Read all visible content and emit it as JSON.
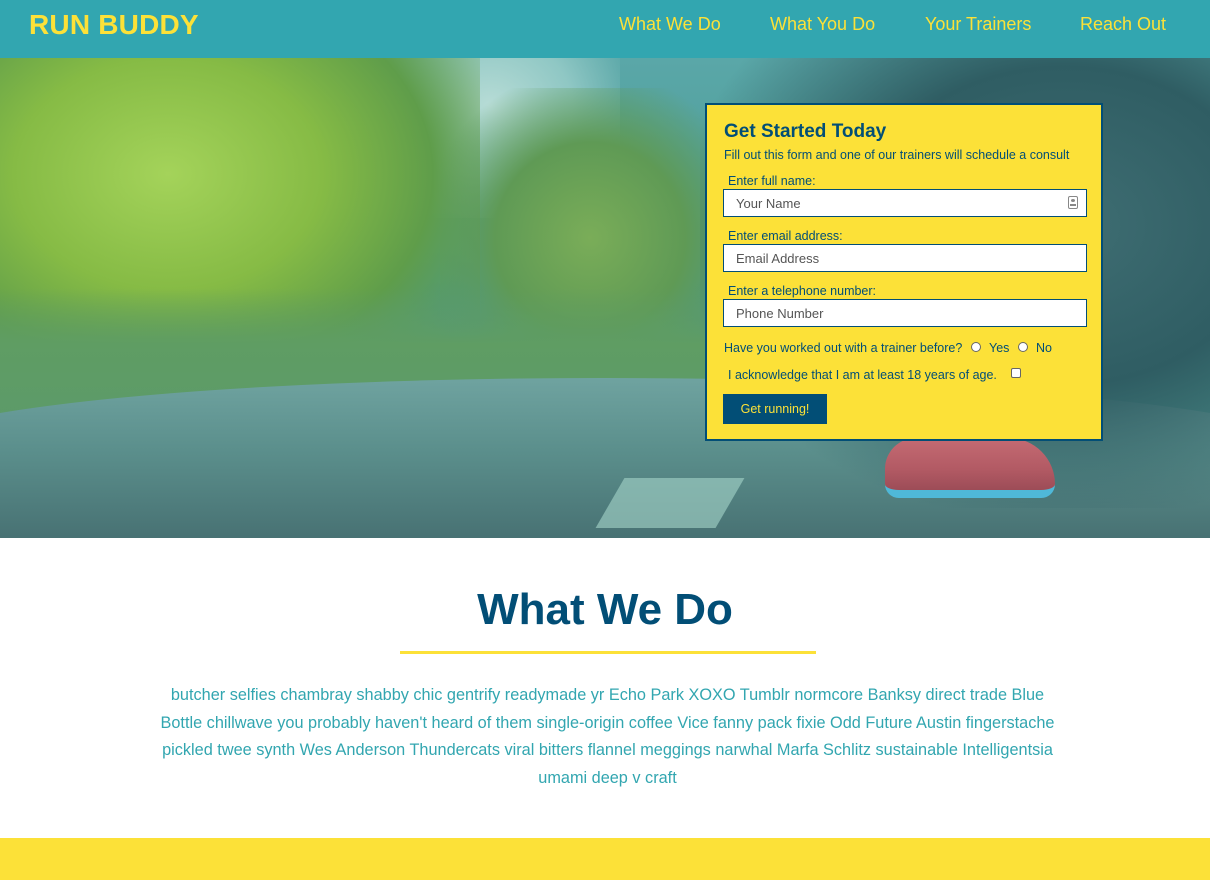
{
  "header": {
    "brand": "RUN BUDDY",
    "nav": [
      {
        "label": "What We Do"
      },
      {
        "label": "What You Do"
      },
      {
        "label": "Your Trainers"
      },
      {
        "label": "Reach Out"
      }
    ]
  },
  "form": {
    "title": "Get Started Today",
    "subtitle": "Fill out this form and one of our trainers will schedule a consult",
    "name_label": "Enter full name:",
    "name_placeholder": "Your Name",
    "email_label": "Enter email address:",
    "email_placeholder": "Email Address",
    "phone_label": "Enter a telephone number:",
    "phone_placeholder": "Phone Number",
    "trainer_question": "Have you worked out with a trainer before?",
    "yes_label": "Yes",
    "no_label": "No",
    "age_ack": "I acknowledge that I am at least 18 years of age.",
    "submit_label": "Get running!"
  },
  "what_we_do": {
    "title": "What We Do",
    "body": "butcher selfies chambray shabby chic gentrify readymade yr Echo Park XOXO Tumblr normcore Banksy direct trade Blue Bottle chillwave you probably haven't heard of them single-origin coffee Vice fanny pack fixie Odd Future Austin fingerstache pickled twee synth Wes Anderson Thundercats viral bitters flannel meggings narwhal Marfa Schlitz sustainable Intelligentsia umami deep v craft"
  },
  "colors": {
    "teal": "#32a6b0",
    "yellow": "#fce138",
    "navy": "#024e76"
  }
}
